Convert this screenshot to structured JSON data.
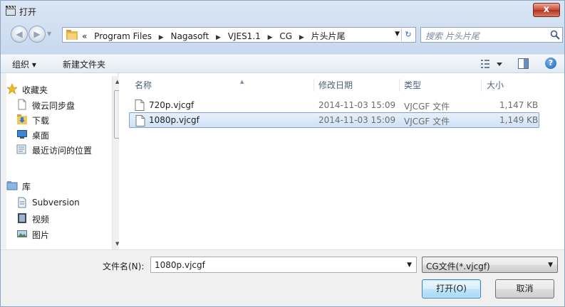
{
  "window": {
    "title": "打开",
    "close_label": "x"
  },
  "address": {
    "crumbs": [
      "Program Files",
      "Nagasoft",
      "VJES1.1",
      "CG",
      "片头片尾"
    ],
    "overflow": "«"
  },
  "search": {
    "placeholder": "搜索 片头片尾"
  },
  "toolbar": {
    "organize_label": "组织 ▾",
    "new_folder_label": "新建文件夹"
  },
  "sidebar": {
    "favorites": {
      "label": "收藏夹",
      "icon": "star-icon"
    },
    "items": [
      {
        "label": "微云同步盘",
        "icon": "document-icon"
      },
      {
        "label": "下载",
        "icon": "download-folder-icon"
      },
      {
        "label": "桌面",
        "icon": "desktop-icon"
      },
      {
        "label": "最近访问的位置",
        "icon": "recent-places-icon"
      }
    ],
    "libraries": {
      "label": "库",
      "icon": "library-icon"
    },
    "library_items": [
      {
        "label": "Subversion",
        "icon": "document-icon"
      },
      {
        "label": "视频",
        "icon": "video-icon"
      },
      {
        "label": "图片",
        "icon": "picture-icon"
      }
    ]
  },
  "files": {
    "columns": [
      "名称",
      "修改日期",
      "类型",
      "大小"
    ],
    "rows": [
      {
        "name": "720p.vjcgf",
        "date": "2014-11-03 15:09",
        "type": "VJCGF 文件",
        "size": "1,147 KB",
        "selected": false
      },
      {
        "name": "1080p.vjcgf",
        "date": "2014-11-03 15:09",
        "type": "VJCGF 文件",
        "size": "1,149 KB",
        "selected": true
      }
    ]
  },
  "bottom": {
    "filename_label": "文件名(N):",
    "filename_value": "1080p.vjcgf",
    "filetype_value": "CG文件(*.vjcgf)",
    "open_label": "打开(O)",
    "cancel_label": "取消"
  },
  "colors": {
    "accent": "#2c6ab9",
    "selection": "#cfe2f7",
    "selection_border": "#7da2ce",
    "close_red": "#c94a36"
  }
}
